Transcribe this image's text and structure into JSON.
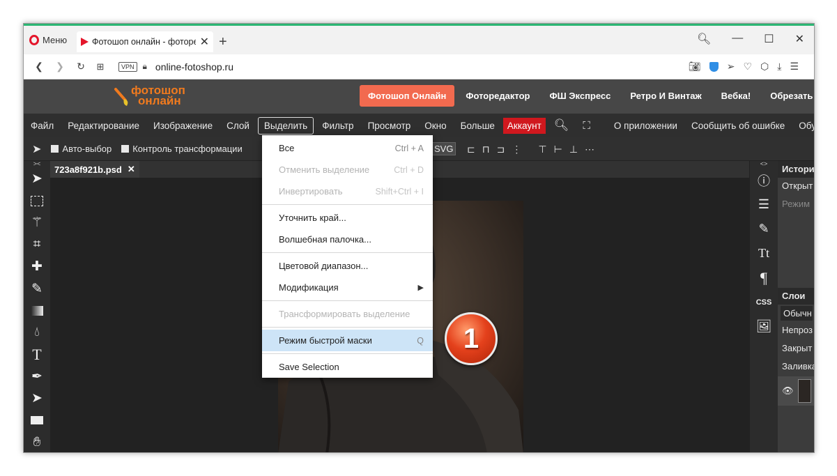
{
  "browser": {
    "menu_label": "Меню",
    "tab_title": "Фотошоп онлайн - фоторедактор",
    "url": "online-fotoshop.ru",
    "vpn": "VPN"
  },
  "site": {
    "logo_line1": "фотошоп",
    "logo_line2": "онлайн",
    "nav": [
      "Фотошоп Онлайн",
      "Фоторедактор",
      "ФШ Экспресс",
      "Ретро И Винтаж",
      "Вебка!",
      "Обрезать Фото"
    ]
  },
  "menubar": {
    "file": "Файл",
    "edit": "Редактирование",
    "image": "Изображение",
    "layer": "Слой",
    "select": "Выделить",
    "filter": "Фильтр",
    "view": "Просмотр",
    "window": "Окно",
    "more": "Больше",
    "account": "Аккаунт",
    "about": "О приложении",
    "report": "Сообщить об ошибке",
    "more2": "Обу"
  },
  "options": {
    "auto_select": "Авто-выбор",
    "transform": "Контроль трансформации",
    "svg": "SVG"
  },
  "document": {
    "tab_name": "723a8f921b.psd"
  },
  "dropdown": {
    "all": "Все",
    "all_sc": "Ctrl + A",
    "deselect": "Отменить выделение",
    "deselect_sc": "Ctrl + D",
    "invert": "Инвертировать",
    "invert_sc": "Shift+Ctrl + I",
    "refine": "Уточнить край...",
    "magic": "Волшебная палочка...",
    "color_range": "Цветовой диапазон...",
    "modify": "Модификация",
    "transform_sel": "Трансформировать выделение",
    "quick_mask": "Режим быстрой маски",
    "quick_mask_sc": "Q",
    "save_sel": "Save Selection"
  },
  "panels": {
    "history": "Истори",
    "open": "Открыт",
    "mode": "Режим",
    "layers": "Слои",
    "normal": "Обычн",
    "opacity": "Непроз",
    "lock": "Закрыт",
    "fill": "Заливка"
  },
  "badge": "1",
  "colors": {
    "accent": "#f26a4f",
    "account": "#d0181e",
    "highlight": "#cde4f7",
    "opera": "#e4162b"
  }
}
